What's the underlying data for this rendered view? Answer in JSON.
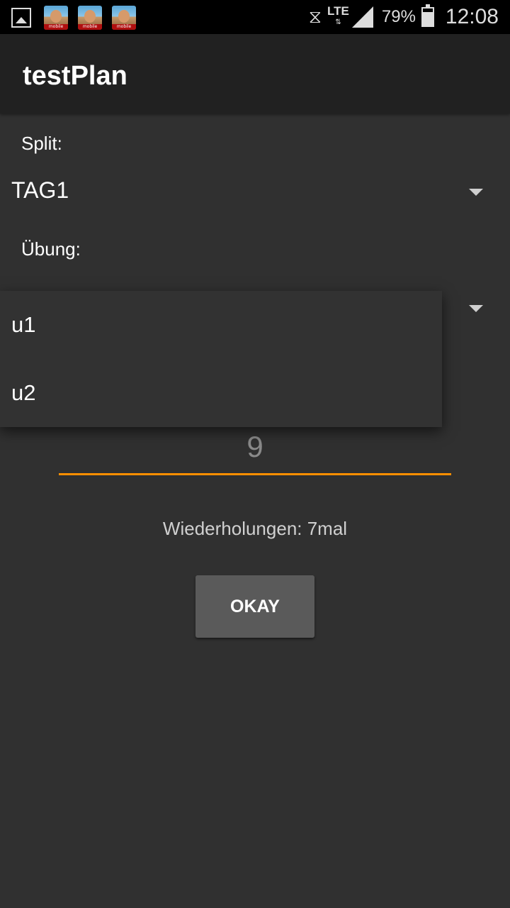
{
  "status_bar": {
    "icons": [
      "gallery-icon",
      "app-icon",
      "app-icon",
      "app-icon"
    ],
    "app_icon_tag": "mobile",
    "network": "LTE",
    "battery_percent": "79%",
    "battery_level": 0.79,
    "time": "12:08"
  },
  "app_bar": {
    "title": "testPlan"
  },
  "form": {
    "split_label": "Split:",
    "split_value": "TAG1",
    "exercise_label": "Übung:",
    "number_value": "9",
    "repetitions_text": "Wiederholungen: 7mal",
    "okay_label": "OKAY"
  },
  "dropdown": {
    "options": [
      "u1",
      "u2"
    ]
  },
  "colors": {
    "background": "#303030",
    "app_bar": "#212121",
    "accent": "#ff8f00",
    "button": "#5a5a5a"
  }
}
